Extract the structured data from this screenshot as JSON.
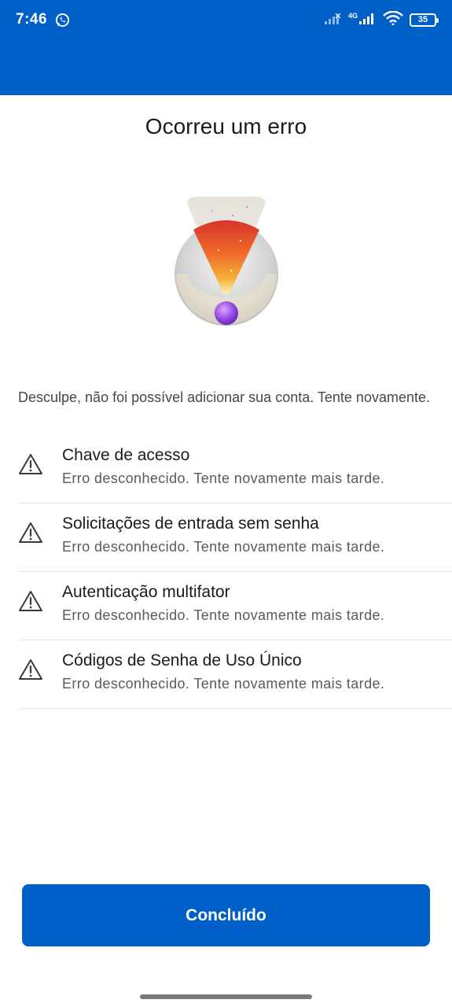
{
  "status_bar": {
    "time": "7:46",
    "network": "4G",
    "battery": "35"
  },
  "page": {
    "title": "Ocorreu um erro",
    "intro": "Desculpe, não foi possível adicionar sua conta. Tente novamente."
  },
  "errors": [
    {
      "title": "Chave de acesso",
      "message": "Erro desconhecido. Tente novamente mais tarde."
    },
    {
      "title": "Solicitações de entrada sem senha",
      "message": "Erro desconhecido. Tente novamente mais tarde."
    },
    {
      "title": "Autenticação multifator",
      "message": "Erro desconhecido. Tente novamente mais tarde."
    },
    {
      "title": "Códigos de Senha de Uso Único",
      "message": "Erro desconhecido. Tente novamente mais tarde."
    }
  ],
  "actions": {
    "done_label": "Concluído"
  },
  "colors": {
    "brand_blue": "#0060c8",
    "divider": "#e3e3e3"
  },
  "icons": {
    "status": [
      "whatsapp-icon",
      "signal-icon",
      "wifi-icon",
      "battery-icon"
    ],
    "illustration": "error-exclamation-illustration",
    "row": "warning-triangle-icon"
  }
}
